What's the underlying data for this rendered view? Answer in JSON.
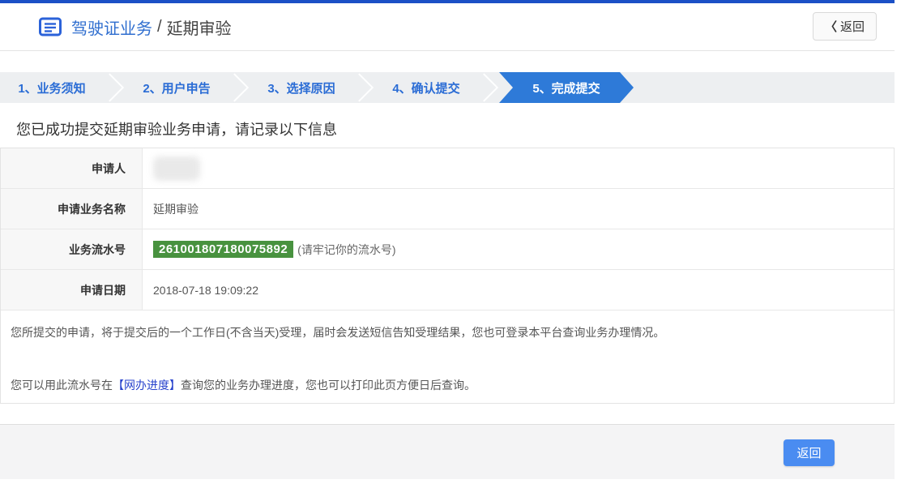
{
  "colors": {
    "topbar": "#1b50c6",
    "icon_blue": "#2b62d9",
    "step_active_bg": "#2e7ad8",
    "serial_badge_bg": "#48923f",
    "footer_button_bg": "#4a8cf1",
    "link_text": "#2742cc"
  },
  "header": {
    "title_primary": "驾驶证业务",
    "title_separator": "/",
    "title_secondary": "延期审验",
    "back_chevron": "〈",
    "back_button_label": "返回"
  },
  "steps": {
    "items": [
      {
        "label": "1、业务须知",
        "active": false
      },
      {
        "label": "2、用户申告",
        "active": false
      },
      {
        "label": "3、选择原因",
        "active": false
      },
      {
        "label": "4、确认提交",
        "active": false
      },
      {
        "label": "5、完成提交",
        "active": true
      }
    ]
  },
  "main": {
    "success_message": "您已成功提交延期审验业务申请，请记录以下信息",
    "table": {
      "rows": [
        {
          "label": "申请人",
          "value": "",
          "redacted": true
        },
        {
          "label": "申请业务名称",
          "value": "延期审验"
        },
        {
          "label": "业务流水号",
          "serial": "261001807180075892",
          "note": "(请牢记你的流水号)"
        },
        {
          "label": "申请日期",
          "value": "2018-07-18 19:09:22"
        }
      ]
    },
    "notes": {
      "paragraph1": "您所提交的申请，将于提交后的一个工作日(不含当天)受理，届时会发送短信告知受理结果，您也可登录本平台查询业务办理情况。",
      "paragraph2_prefix": "您可以用此流水号在",
      "paragraph2_link": "【网办进度】",
      "paragraph2_suffix": "查询您的业务办理进度，您也可以打印此页方便日后查询。"
    }
  },
  "footer": {
    "back_button_label": "返回"
  }
}
